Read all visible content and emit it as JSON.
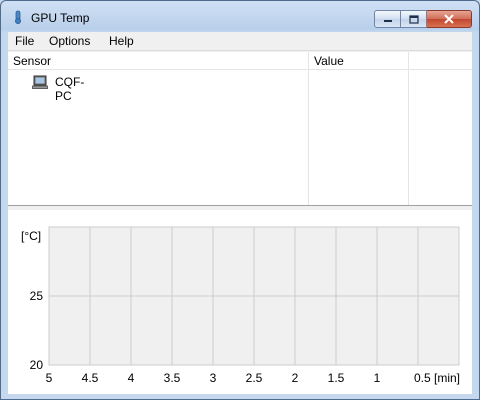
{
  "window": {
    "title": "GPU Temp"
  },
  "menu": {
    "items": [
      "File",
      "Options",
      "Help"
    ]
  },
  "sensor_list": {
    "columns": [
      "Sensor",
      "Value"
    ],
    "rows": [
      {
        "name": "CQF-PC",
        "value": ""
      }
    ]
  },
  "chart_data": {
    "type": "line",
    "title": "",
    "ylabel": "[°C]",
    "xlabel": "",
    "x_ticks": [
      "5",
      "4.5",
      "4",
      "3.5",
      "3",
      "2.5",
      "2",
      "1.5",
      "1",
      "0.5 [min]"
    ],
    "y_ticks": [
      "25",
      "20"
    ],
    "ylim": [
      20,
      30
    ],
    "xlim": [
      5,
      0
    ],
    "grid": true,
    "series": [],
    "colors": {
      "plot_bg": "#f0f0f0",
      "grid": "#cccccc"
    }
  },
  "colors": {
    "title_bar": "#c6d8ee",
    "close_button": "#c24630"
  }
}
